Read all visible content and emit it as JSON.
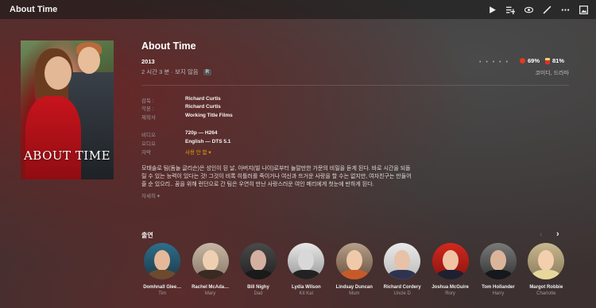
{
  "window": {
    "title": "About Time"
  },
  "toolbar": {
    "icons": [
      "play-icon",
      "add-to-playlist-icon",
      "watched-eye-icon",
      "edit-pencil-icon",
      "more-icon",
      "artwork-icon"
    ]
  },
  "poster": {
    "title_text": "ABOUT TIME"
  },
  "movie": {
    "title": "About Time",
    "year": "2013",
    "duration": "2 시간 3 분",
    "watched_status": "보지 않음",
    "rating_badge": "R",
    "stars": "• • • • •",
    "critic_score": "69%",
    "audience_score": "81%",
    "genres": "코미디, 드라마"
  },
  "credits": [
    {
      "label": "감독 :",
      "value": "Richard Curtis"
    },
    {
      "label": "각본 :",
      "value": "Richard Curtis"
    },
    {
      "label": "제작사",
      "value": "Working Title Films"
    }
  ],
  "media": [
    {
      "label": "비디오",
      "value": "720p — H264"
    },
    {
      "label": "오디오",
      "value": "English — DTS 5.1"
    },
    {
      "label": "자막",
      "value": "사용 안 함 ▾"
    }
  ],
  "summary": "모태솔로 팀(돔놀 글리슨)은 성인이 된 날, 아버지(빌 나이)로부터 놀랄만한 가문의 비밀을 듣게 된다. 바로 시간을 되돌릴 수 있는 능력이 있다는 것! 그것이 비록 히틀러를 죽이거나 여신과 뜨거운 사랑을 할 수는 없지만, 여자친구는 만들어 줄 순 있으리.. 꿈을 위해 런던으로 간 팀은 우연히 만난 사랑스러운 여인 메리에게 첫눈에 반하게 된다.",
  "more_label": "자세히 ▾",
  "cast_section": {
    "title": "출연",
    "prev": "‹",
    "next": "›",
    "people": [
      {
        "name": "Domhnall Glee…",
        "role": "Tim"
      },
      {
        "name": "Rachel McAda…",
        "role": "Mary"
      },
      {
        "name": "Bill Nighy",
        "role": "Dad"
      },
      {
        "name": "Lydia Wilson",
        "role": "Kit Kat"
      },
      {
        "name": "Lindsay Duncan",
        "role": "Mum"
      },
      {
        "name": "Richard Cordery",
        "role": "Uncle D"
      },
      {
        "name": "Joshua McGuire",
        "role": "Rory"
      },
      {
        "name": "Tom Hollander",
        "role": "Harry"
      },
      {
        "name": "Margot Robbie",
        "role": "Charlotte"
      }
    ]
  },
  "colors": {
    "accent": "#e5a00d",
    "topbar": "#1c1c1c"
  }
}
